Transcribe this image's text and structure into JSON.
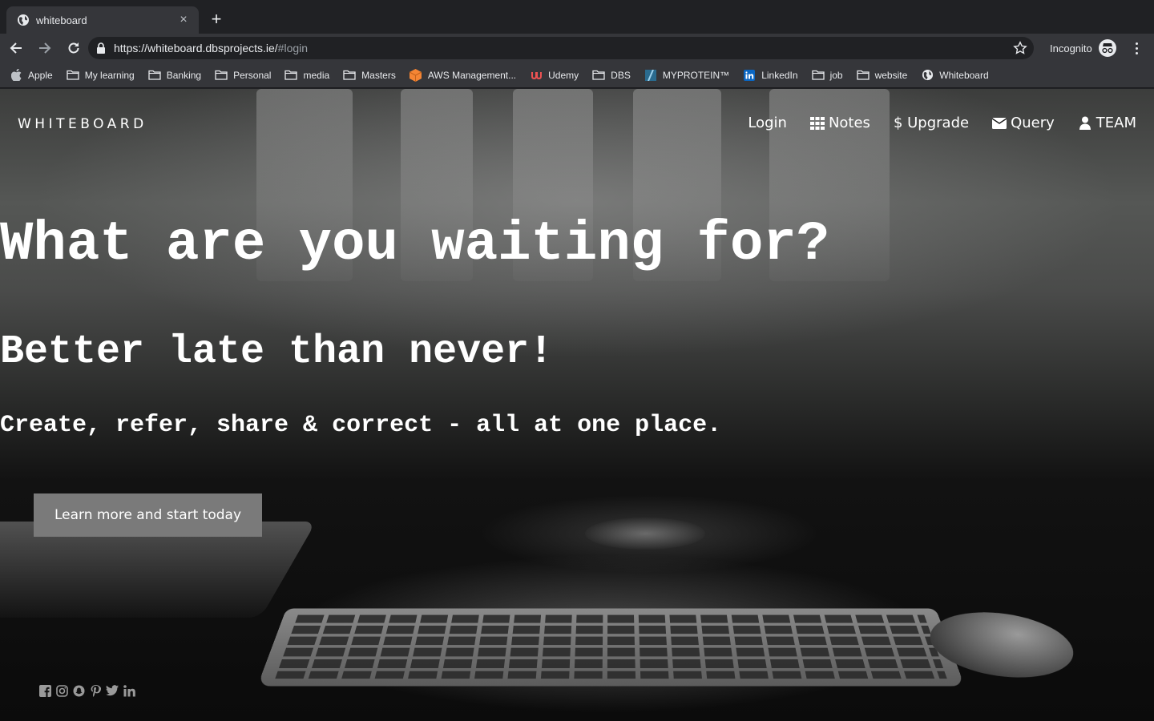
{
  "browser": {
    "tab_title": "whiteboard",
    "tab_close": "×",
    "new_tab": "+",
    "url_host": "https://whiteboard.dbsprojects.ie/",
    "url_path": "#login",
    "incognito_label": "Incognito"
  },
  "bookmarks": [
    {
      "label": "Apple",
      "icon": "apple-icon"
    },
    {
      "label": "My learning",
      "icon": "folder-icon"
    },
    {
      "label": "Banking",
      "icon": "folder-icon"
    },
    {
      "label": "Personal",
      "icon": "folder-icon"
    },
    {
      "label": "media",
      "icon": "folder-icon"
    },
    {
      "label": "Masters",
      "icon": "folder-icon"
    },
    {
      "label": "AWS Management...",
      "icon": "aws-icon"
    },
    {
      "label": "Udemy",
      "icon": "udemy-icon"
    },
    {
      "label": "DBS",
      "icon": "folder-icon"
    },
    {
      "label": "MYPROTEIN™",
      "icon": "myprotein-icon"
    },
    {
      "label": "LinkedIn",
      "icon": "linkedin-icon"
    },
    {
      "label": "job",
      "icon": "folder-icon"
    },
    {
      "label": "website",
      "icon": "folder-icon"
    },
    {
      "label": "Whiteboard",
      "icon": "globe-icon"
    }
  ],
  "site": {
    "brand": "WHITEBOARD",
    "nav": {
      "login": "Login",
      "notes": "Notes",
      "upgrade": "$ Upgrade",
      "query": "Query",
      "team": "TEAM"
    },
    "headline": "What are you waiting for?",
    "subhead": "Better late than never!",
    "tagline": "Create, refer, share & correct - all at one place.",
    "cta": "Learn more and start today",
    "social_icons": [
      "facebook-icon",
      "instagram-icon",
      "snapchat-icon",
      "pinterest-icon",
      "twitter-icon",
      "linkedin-icon"
    ]
  },
  "colors": {
    "chrome_dark": "#202124",
    "chrome_toolbar": "#35363a",
    "cta_bg": "#7a7a7a",
    "text_white": "#ffffff"
  }
}
